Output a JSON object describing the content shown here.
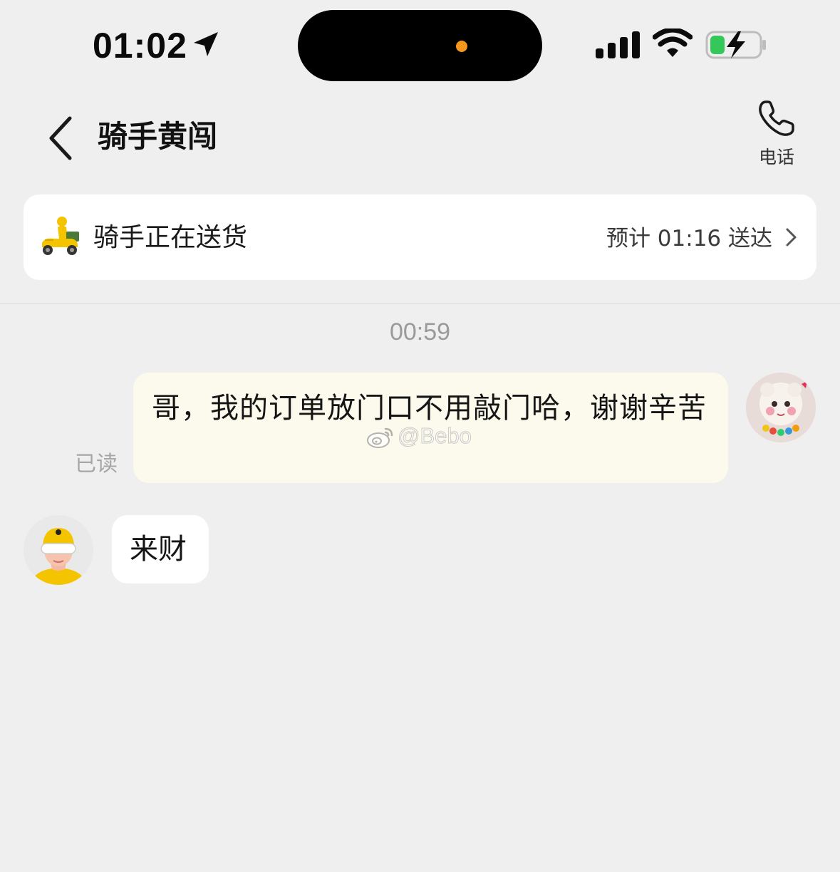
{
  "status_bar": {
    "time": "01:02",
    "icons": [
      "location-arrow-icon",
      "signal-icon",
      "wifi-icon",
      "battery-charging-icon"
    ],
    "island_indicator_color": "#f6961c",
    "battery_color": "#34c759"
  },
  "header": {
    "back_icon": "chevron-left-icon",
    "title": "骑手黄闯",
    "phone_label": "电话",
    "phone_icon": "phone-icon"
  },
  "delivery": {
    "icon": "scooter-rider-icon",
    "status": "骑手正在送货",
    "eta": "预计 01:16 送达",
    "accent_color": "#f5c400"
  },
  "chat": {
    "timestamp": "00:59",
    "messages": [
      {
        "direction": "outgoing",
        "text": "哥，我的订单放门口不用敲门哈，谢谢辛苦",
        "read_receipt": "已读",
        "bubble_color": "#fcfaec"
      },
      {
        "direction": "incoming",
        "text": "来财",
        "bubble_color": "#ffffff"
      }
    ]
  },
  "watermark": {
    "icon": "weibo-icon",
    "text": "@Bebo"
  }
}
